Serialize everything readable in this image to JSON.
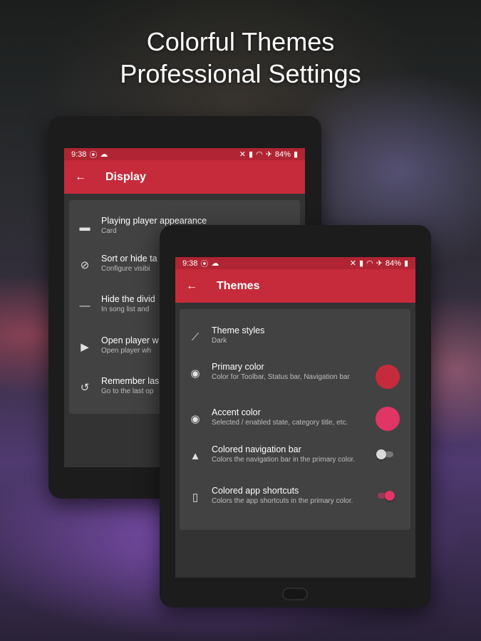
{
  "headline": {
    "line1": "Colorful Themes",
    "line2": "Professional Settings"
  },
  "back_device": {
    "status": {
      "time": "9:38",
      "battery": "84%"
    },
    "toolbar": {
      "title": "Display"
    },
    "items": [
      {
        "title": "Playing player appearance",
        "subtitle": "Card",
        "icon": "player-appearance-icon"
      },
      {
        "title": "Sort or hide ta",
        "subtitle": "Configure visibi",
        "icon": "eye-off-icon"
      },
      {
        "title": "Hide the divid",
        "subtitle": "In song list and",
        "icon": "divider-icon"
      },
      {
        "title": "Open player w",
        "subtitle": "Open player wh",
        "icon": "play-queue-icon"
      },
      {
        "title": "Remember las",
        "subtitle": "Go to the last op",
        "icon": "history-icon"
      }
    ]
  },
  "front_device": {
    "status": {
      "time": "9:38",
      "battery": "84%"
    },
    "toolbar": {
      "title": "Themes"
    },
    "items": [
      {
        "title": "Theme styles",
        "subtitle": "Dark",
        "icon": "brush-icon"
      },
      {
        "title": "Primary color",
        "subtitle": "Color for Toolbar, Status bar, Navigation bar",
        "icon": "palette-icon",
        "swatch_color": "#c62b3b"
      },
      {
        "title": "Accent color",
        "subtitle": "Selected / enabled state, category title, etc.",
        "icon": "palette-icon",
        "swatch_color": "#e03565"
      },
      {
        "title": "Colored navigation bar",
        "subtitle": "Colors the navigation bar in the primary color.",
        "icon": "shapes-icon",
        "toggle": false
      },
      {
        "title": "Colored app shortcuts",
        "subtitle": "Colors the app shortcuts in the primary color.",
        "icon": "phone-icon",
        "toggle": true
      }
    ]
  },
  "colors": {
    "toolbar": "#c62b3b",
    "statusbar": "#b02433",
    "accent": "#e03565",
    "card": "#424242",
    "screen": "#333333"
  }
}
